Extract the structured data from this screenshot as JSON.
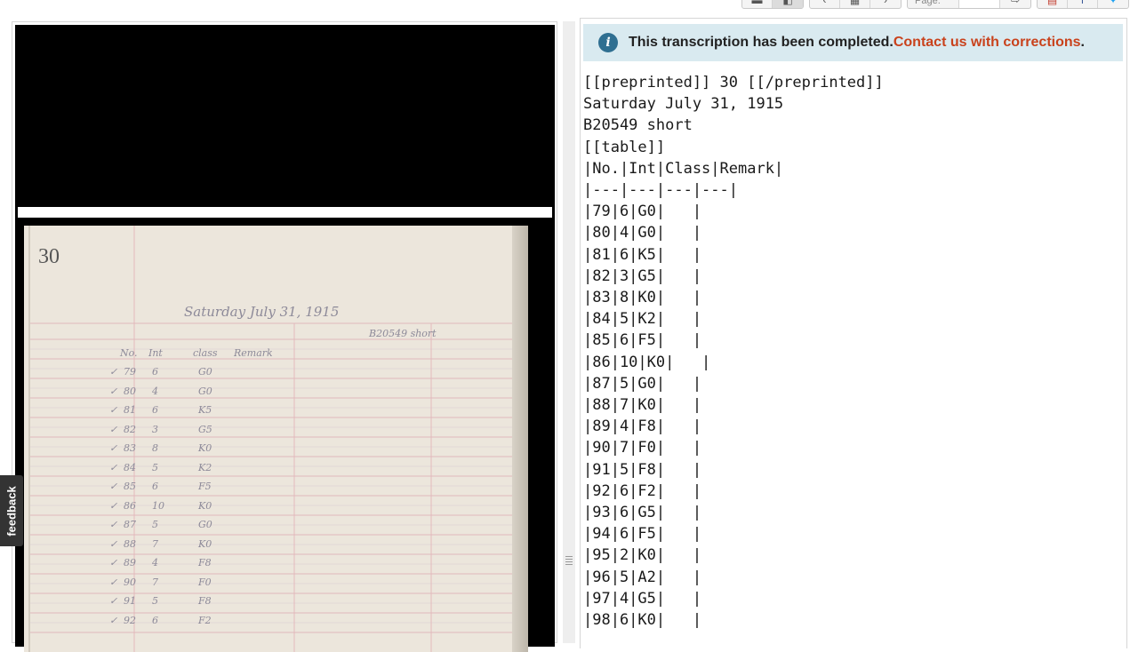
{
  "toolbar": {
    "page_label": "Page:",
    "page_value": ""
  },
  "image": {
    "page_number": "30",
    "date_line": "Saturday July 31, 1915",
    "plate_note": "B20549 short",
    "headers": [
      "No.",
      "Int",
      "class",
      "Remark"
    ],
    "rows": [
      {
        "no": "79",
        "int": "6",
        "cls": "G0"
      },
      {
        "no": "80",
        "int": "4",
        "cls": "G0"
      },
      {
        "no": "81",
        "int": "6",
        "cls": "K5"
      },
      {
        "no": "82",
        "int": "3",
        "cls": "G5"
      },
      {
        "no": "83",
        "int": "8",
        "cls": "K0"
      },
      {
        "no": "84",
        "int": "5",
        "cls": "K2"
      },
      {
        "no": "85",
        "int": "6",
        "cls": "F5"
      },
      {
        "no": "86",
        "int": "10",
        "cls": "K0"
      },
      {
        "no": "87",
        "int": "5",
        "cls": "G0"
      },
      {
        "no": "88",
        "int": "7",
        "cls": "K0"
      },
      {
        "no": "89",
        "int": "4",
        "cls": "F8"
      },
      {
        "no": "90",
        "int": "7",
        "cls": "F0"
      },
      {
        "no": "91",
        "int": "5",
        "cls": "F8"
      },
      {
        "no": "92",
        "int": "6",
        "cls": "F2"
      }
    ]
  },
  "notice": {
    "text": "This transcription has been completed. ",
    "link": "Contact us with corrections",
    "end": "."
  },
  "transcript": [
    "[[preprinted]] 30 [[/preprinted]]",
    "Saturday July 31, 1915",
    "B20549 short",
    "[[table]]",
    "|No.|Int|Class|Remark|",
    "|---|---|---|---|",
    "|79|6|G0|   |",
    "|80|4|G0|   |",
    "|81|6|K5|   |",
    "|82|3|G5|   |",
    "|83|8|K0|   |",
    "|84|5|K2|   |",
    "|85|6|F5|   |",
    "|86|10|K0|   |",
    "|87|5|G0|   |",
    "|88|7|K0|   |",
    "|89|4|F8|   |",
    "|90|7|F0|   |",
    "|91|5|F8|   |",
    "|92|6|F2|   |",
    "|93|6|G5|   |",
    "|94|6|F5|   |",
    "|95|2|K0|   |",
    "|96|5|A2|   |",
    "|97|4|G5|   |",
    "|98|6|K0|   |"
  ],
  "feedback_label": "feedback",
  "colors": {
    "notice_bg": "#d9eaf0",
    "link": "#c9421c",
    "info_icon": "#2f6f91"
  }
}
